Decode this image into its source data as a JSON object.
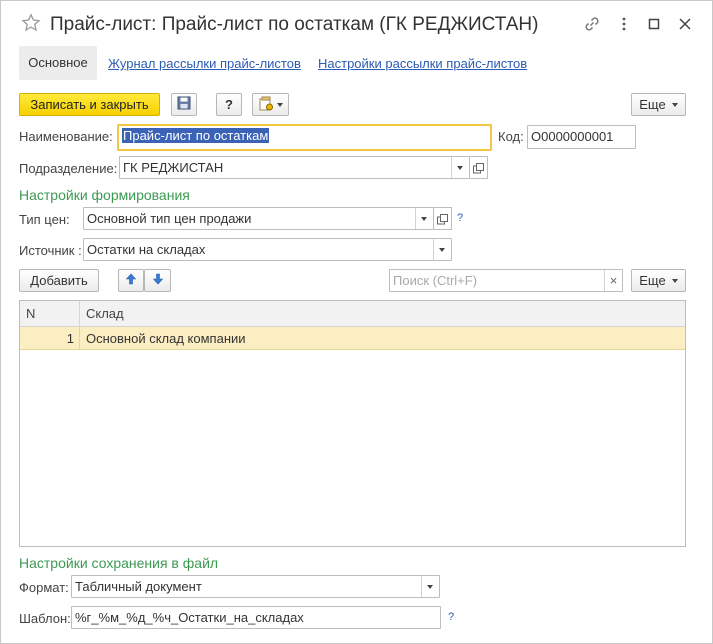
{
  "window": {
    "title": "Прайс-лист: Прайс-лист по остаткам (ГК РЕДЖИСТАН)"
  },
  "tabs": [
    {
      "label": "Основное",
      "active": true
    },
    {
      "label": "Журнал рассылки прайс-листов"
    },
    {
      "label": "Настройки рассылки прайс-листов"
    }
  ],
  "toolbar": {
    "save_close_label": "Записать и закрыть",
    "help_label": "?",
    "more_label": "Еще"
  },
  "form": {
    "name_label": "Наименование:",
    "name_value": "Прайс-лист по остаткам",
    "code_label": "Код:",
    "code_value": "О0000000001",
    "division_label": "Подразделение:",
    "division_value": "ГК РЕДЖИСТАН"
  },
  "generation": {
    "section_title": "Настройки формирования",
    "price_type_label": "Тип цен:",
    "price_type_value": "Основной тип цен продажи",
    "price_type_help": "?",
    "source_label": "Источник :",
    "source_value": "Остатки на складах"
  },
  "table_toolbar": {
    "add_label": "Добавить",
    "search_placeholder": "Поиск (Ctrl+F)",
    "clear_label": "×",
    "more_label": "Еще"
  },
  "table": {
    "columns": [
      "N",
      "Склад"
    ],
    "rows": [
      {
        "n": "1",
        "warehouse": "Основной склад компании"
      }
    ]
  },
  "file_settings": {
    "section_title": "Настройки сохранения в файл",
    "format_label": "Формат:",
    "format_value": "Табличный документ",
    "template_label": "Шаблон:",
    "template_value": "%г_%м_%д_%ч_Остатки_на_складах",
    "template_help": "?"
  },
  "colors": {
    "accent_yellow": "#f7d100",
    "section_green": "#3a9a52",
    "link_blue": "#2c5bb3",
    "row_highlight": "#fbeec2"
  }
}
